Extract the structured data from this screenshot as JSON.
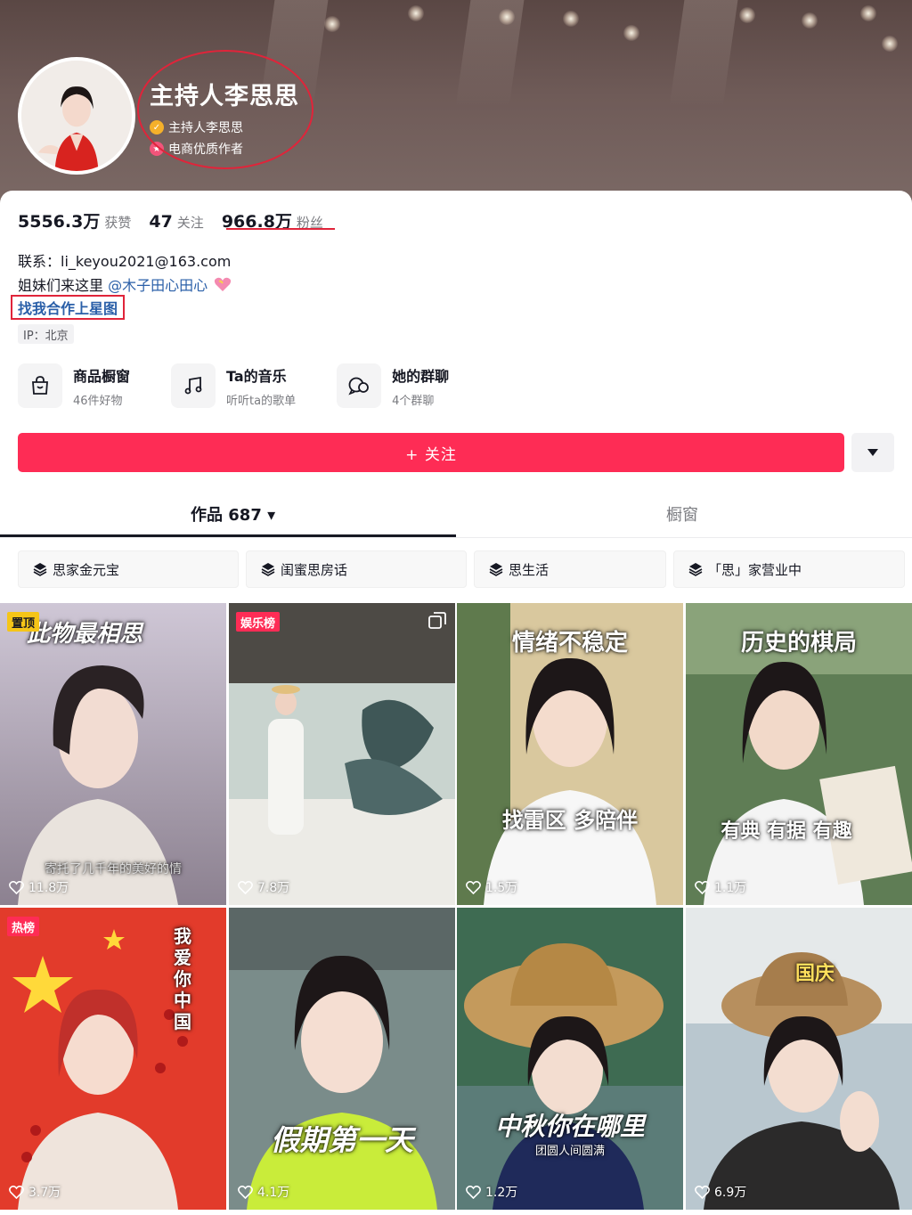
{
  "profile": {
    "nickname": "主持人李思思",
    "verified_label": "主持人李思思",
    "creator_label": "电商优质作者"
  },
  "stats": [
    {
      "value": "5556.3万",
      "label": "获赞"
    },
    {
      "value": "47",
      "label": "关注"
    },
    {
      "value": "966.8万",
      "label": "粉丝"
    }
  ],
  "bio": {
    "contact": "联系：li_keyou2021@163.com",
    "line2_text": "姐妹们来这里",
    "mention": "@木子田心田心",
    "star_link": "找我合作上星图",
    "ip": "IP：北京"
  },
  "shortcuts": [
    {
      "title": "商品橱窗",
      "sub": "46件好物",
      "icon": "shopping-bag-icon"
    },
    {
      "title": "Ta的音乐",
      "sub": "听听ta的歌单",
      "icon": "music-note-icon"
    },
    {
      "title": "她的群聊",
      "sub": "4个群聊",
      "icon": "group-chat-icon"
    }
  ],
  "actions": {
    "follow_label": "+ 关注",
    "more_icon": "caret-down-icon"
  },
  "tabs": {
    "works_label": "作品 687 ▾",
    "shop_label": "橱窗"
  },
  "collections": [
    "思家金元宝",
    "闺蜜思房话",
    "思生活",
    "「思」家营业中"
  ],
  "videos": [
    {
      "tag": "置顶",
      "title": "此物最相思",
      "caption": "寄托了几千年的美好的情",
      "likes": "11.8万"
    },
    {
      "tag": "娱乐榜",
      "title": "",
      "caption": "",
      "likes": "7.8万"
    },
    {
      "tag": "",
      "title": "情绪不稳定",
      "caption": "找雷区 多陪伴",
      "likes": "1.5万"
    },
    {
      "tag": "",
      "title": "历史的棋局",
      "caption": "有典 有据 有趣",
      "likes": "1.1万"
    },
    {
      "tag": "热榜",
      "title": "我爱你中国",
      "caption": "",
      "likes": "3.7万"
    },
    {
      "tag": "",
      "title": "假期第一天",
      "caption": "",
      "likes": "4.1万"
    },
    {
      "tag": "",
      "title": "中秋你在哪里",
      "caption": "团圆人间圆满",
      "likes": "1.2万"
    },
    {
      "tag": "",
      "title": "国庆",
      "caption": "",
      "likes": "6.9万"
    }
  ],
  "colors": {
    "accent": "#fe2c55",
    "annotation_red": "#e0243a",
    "mention_blue": "#2a5fa8"
  }
}
